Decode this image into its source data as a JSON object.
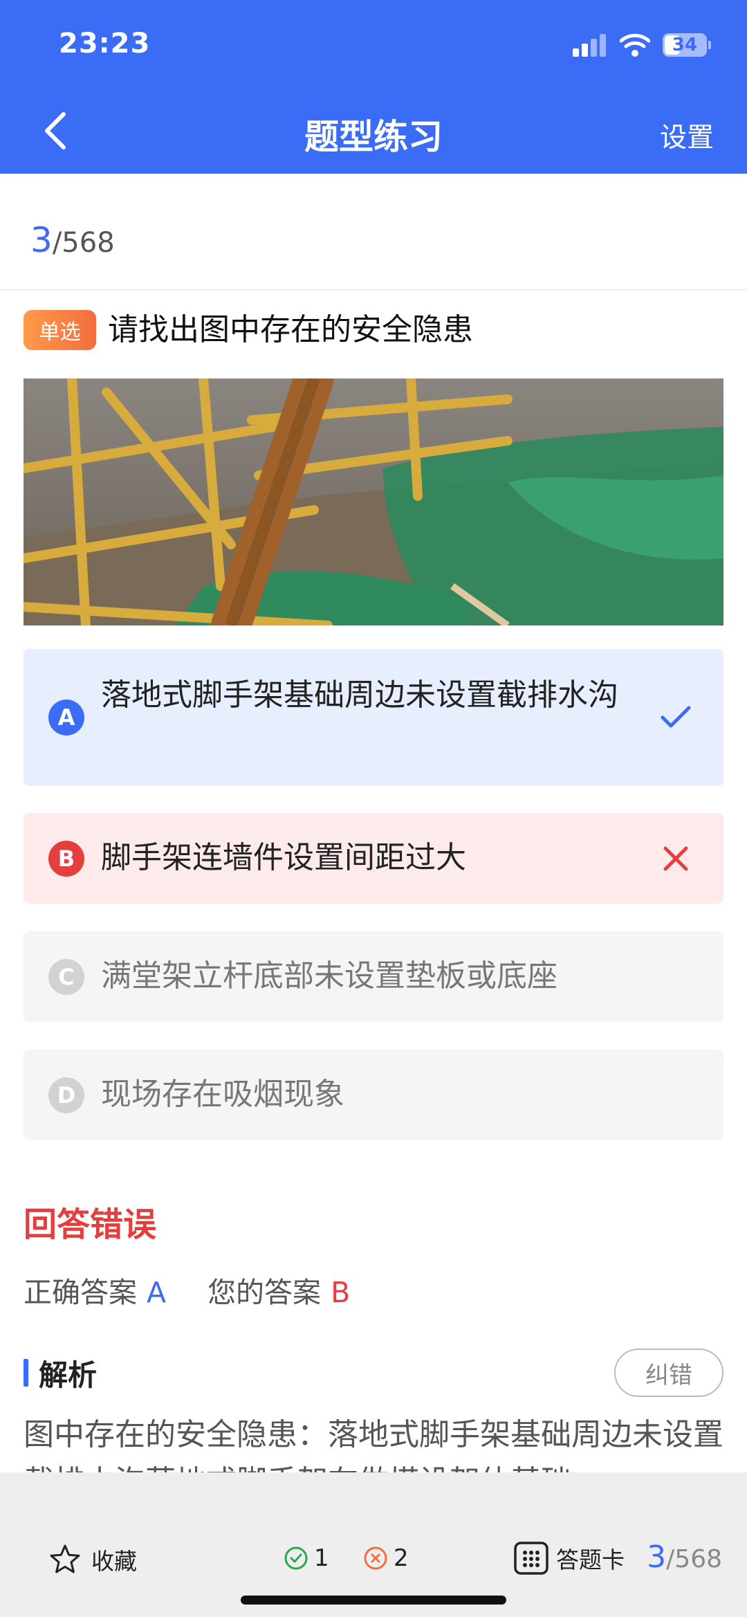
{
  "status_bar": {
    "time": "23:23",
    "battery": "34"
  },
  "nav": {
    "title": "题型练习",
    "settings_label": "设置"
  },
  "progress": {
    "current": "3",
    "total": "/568"
  },
  "question": {
    "type_badge": "单选",
    "text": "请找出图中存在的安全隐患",
    "options": [
      {
        "letter": "A",
        "text": "落地式脚手架基础周边未设置截排水沟",
        "state": "correct"
      },
      {
        "letter": "B",
        "text": "脚手架连墙件设置间距过大",
        "state": "wrong"
      },
      {
        "letter": "C",
        "text": "满堂架立杆底部未设置垫板或底座",
        "state": "neutral"
      },
      {
        "letter": "D",
        "text": "现场存在吸烟现象",
        "state": "neutral"
      }
    ]
  },
  "result": {
    "title": "回答错误",
    "correct_label": "正确答案",
    "correct_value": "A",
    "mine_label": "您的答案",
    "mine_value": "B"
  },
  "analysis": {
    "title": "解析",
    "report_button": "纠错",
    "text": "图中存在的安全隐患：落地式脚手架基础周边未设置截排水沟落地式脚手架在做搭设架体基础"
  },
  "bottom_bar": {
    "favorite_label": "收藏",
    "correct_count": "1",
    "wrong_count": "2",
    "answer_card_label": "答题卡",
    "progress_current": "3",
    "progress_total": "/568"
  },
  "colors": {
    "primary": "#3B6CF5",
    "error": "#E53E3E",
    "success": "#2BA84A",
    "badge": "#F36E3D"
  }
}
